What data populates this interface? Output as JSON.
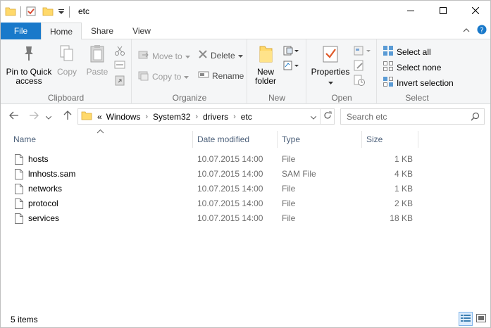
{
  "window": {
    "title": "etc"
  },
  "tabs": {
    "file": "File",
    "home": "Home",
    "share": "Share",
    "view": "View"
  },
  "ribbon": {
    "clipboard": {
      "label": "Clipboard",
      "pin": "Pin to Quick access",
      "copy": "Copy",
      "paste": "Paste"
    },
    "organize": {
      "label": "Organize",
      "move_to": "Move to",
      "copy_to": "Copy to",
      "delete": "Delete",
      "rename": "Rename"
    },
    "new": {
      "label": "New",
      "new_folder": "New folder"
    },
    "open": {
      "label": "Open",
      "properties": "Properties"
    },
    "select": {
      "label": "Select",
      "select_all": "Select all",
      "select_none": "Select none",
      "invert_selection": "Invert selection"
    }
  },
  "address": {
    "overflow": "«",
    "crumbs": [
      "Windows",
      "System32",
      "drivers",
      "etc"
    ]
  },
  "search": {
    "placeholder": "Search etc"
  },
  "columns": {
    "name": "Name",
    "date": "Date modified",
    "type": "Type",
    "size": "Size"
  },
  "files": [
    {
      "name": "hosts",
      "date": "10.07.2015 14:00",
      "type": "File",
      "size": "1 KB"
    },
    {
      "name": "lmhosts.sam",
      "date": "10.07.2015 14:00",
      "type": "SAM File",
      "size": "4 KB"
    },
    {
      "name": "networks",
      "date": "10.07.2015 14:00",
      "type": "File",
      "size": "1 KB"
    },
    {
      "name": "protocol",
      "date": "10.07.2015 14:00",
      "type": "File",
      "size": "2 KB"
    },
    {
      "name": "services",
      "date": "10.07.2015 14:00",
      "type": "File",
      "size": "18 KB"
    }
  ],
  "status": {
    "count": "5 items"
  },
  "colors": {
    "file_tab": "#1979ca",
    "ribbon_bg": "#f5f6f7",
    "header_text": "#4c607a",
    "folder": "#ffd96b"
  }
}
